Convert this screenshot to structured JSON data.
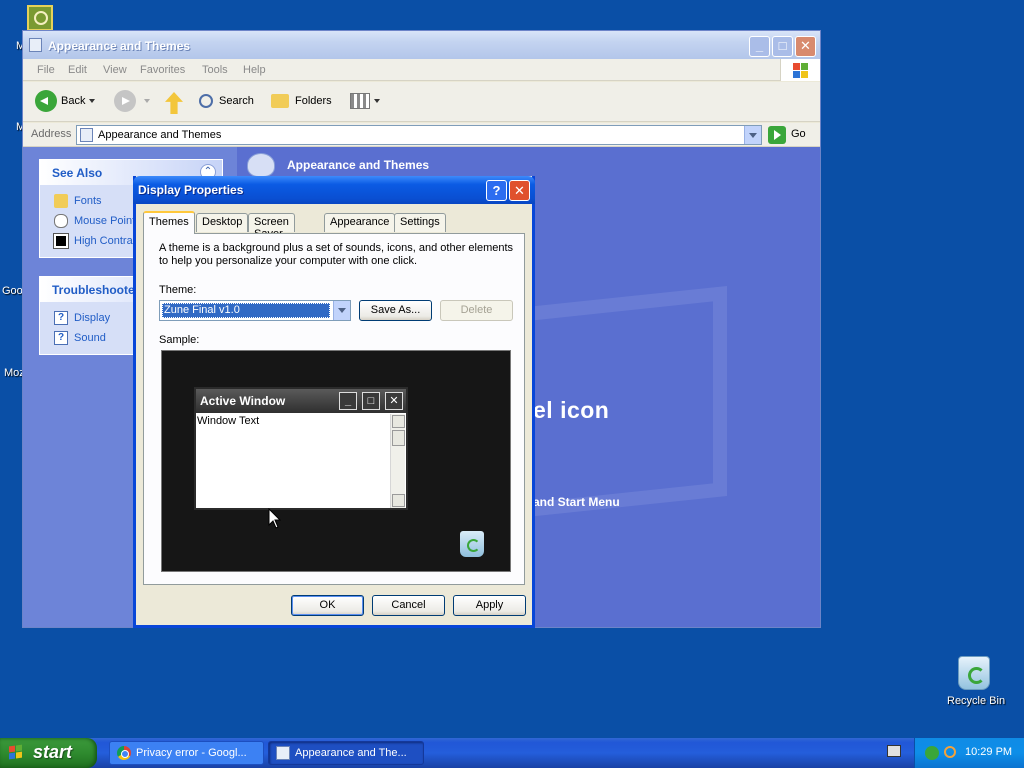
{
  "desktop": {
    "partial_labels": [
      "M",
      "M",
      "Goo",
      "Moz"
    ],
    "recycle_bin_label": "Recycle Bin"
  },
  "explorer": {
    "title": "Appearance and Themes",
    "menu": [
      "File",
      "Edit",
      "View",
      "Favorites",
      "Tools",
      "Help"
    ],
    "toolbar": {
      "back": "Back",
      "search": "Search",
      "folders": "Folders"
    },
    "address": {
      "label": "Address",
      "value": "Appearance and Themes",
      "go": "Go"
    },
    "see_also": {
      "header": "See Also",
      "items": [
        "Fonts",
        "Mouse Point",
        "High Contra"
      ]
    },
    "troubleshooters": {
      "header": "Troubleshoote",
      "items": [
        "Display",
        "Sound"
      ]
    },
    "main": {
      "heading": "Appearance and Themes",
      "partial_heading": "el icon",
      "partial_task": "and Start Menu"
    }
  },
  "dialog": {
    "title": "Display Properties",
    "tabs": [
      "Themes",
      "Desktop",
      "Screen Saver",
      "Appearance",
      "Settings"
    ],
    "description": "A theme is a background plus a set of sounds, icons, and other elements to help you personalize your computer with one click.",
    "theme_label": "Theme:",
    "theme_value": "Zune Final v1.0",
    "save_as": "Save As...",
    "delete": "Delete",
    "sample_label": "Sample:",
    "sample_window": {
      "title": "Active Window",
      "text": "Window Text"
    },
    "buttons": {
      "ok": "OK",
      "cancel": "Cancel",
      "apply": "Apply"
    }
  },
  "taskbar": {
    "start": "start",
    "tasks": [
      "Privacy error - Googl...",
      "Appearance and The..."
    ],
    "clock": "10:29 PM"
  },
  "colors": {
    "desktop": "#0a4fa6",
    "dialog_title": "#0b5be4",
    "link": "#215dc6",
    "selection": "#316ac5"
  }
}
